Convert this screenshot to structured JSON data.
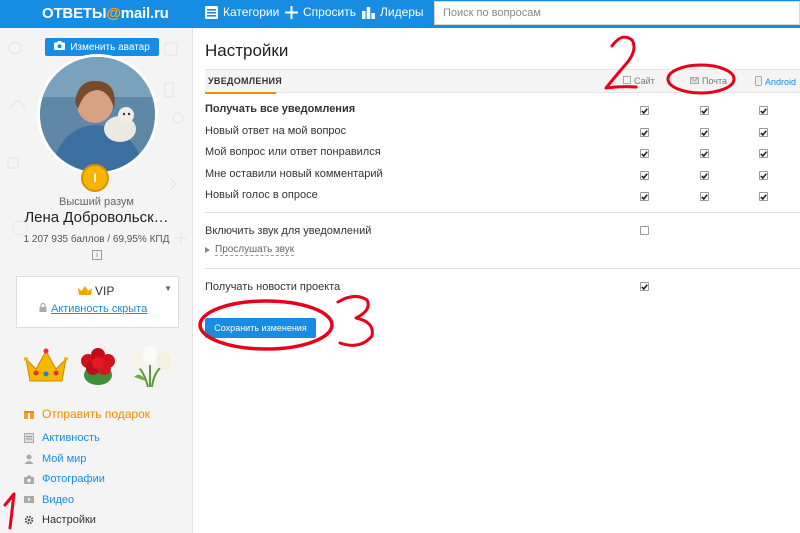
{
  "header": {
    "logo_text": "ОТВЕТЫ",
    "logo_at": "@",
    "logo_mail": "mail.ru",
    "nav": [
      {
        "label": "Категории",
        "icon": "categories-icon"
      },
      {
        "label": "Спросить",
        "icon": "plus-icon"
      },
      {
        "label": "Лидеры",
        "icon": "leaders-icon"
      }
    ],
    "search_placeholder": "Поиск по вопросам",
    "bg_color": "#168de2"
  },
  "sidebar": {
    "change_avatar": "Изменить аватар",
    "rank": "Высший разум",
    "username": "Лена Добровольск…",
    "score": "1 207 935 баллов / 69,95% КПД",
    "vip_label": "VIP",
    "activity_hidden": "Активность скрыта",
    "gifts": [
      "crown",
      "roses",
      "tulips"
    ],
    "menu": [
      {
        "label": "Отправить подарок",
        "icon": "gift-icon"
      },
      {
        "label": "Активность",
        "icon": "activity-icon"
      },
      {
        "label": "Мой мир",
        "icon": "myworld-icon"
      },
      {
        "label": "Фотографии",
        "icon": "camera-icon"
      },
      {
        "label": "Видео",
        "icon": "video-icon"
      },
      {
        "label": "Настройки",
        "icon": "gear-icon"
      }
    ]
  },
  "main": {
    "title": "Настройки",
    "tab": "УВЕДОМЛЕНИЯ",
    "columns": [
      {
        "label": "Сайт",
        "icon": "site-icon"
      },
      {
        "label": "Почта",
        "icon": "mail-icon"
      },
      {
        "label": "Android",
        "icon": "android-icon"
      }
    ],
    "rows": [
      {
        "label": "Получать все уведомления",
        "bold": true,
        "checks": [
          true,
          true,
          true
        ]
      },
      {
        "label": "Новый ответ на мой вопрос",
        "bold": false,
        "checks": [
          true,
          true,
          true
        ]
      },
      {
        "label": "Мой вопрос или ответ понравился",
        "bold": false,
        "checks": [
          true,
          true,
          true
        ]
      },
      {
        "label": "Мне оставили новый комментарий",
        "bold": false,
        "checks": [
          true,
          true,
          true
        ]
      },
      {
        "label": "Новый голос в опросе",
        "bold": false,
        "checks": [
          true,
          true,
          true
        ]
      }
    ],
    "sound_label": "Включить звук для уведомлений",
    "sound_checked": false,
    "listen_label": "Прослушать звук",
    "news_label": "Получать новости проекта",
    "news_checked": true,
    "save_label": "Сохранить изменения"
  },
  "annotations": {
    "numbers": [
      "1",
      "2",
      "3"
    ],
    "color": "#e8001c"
  }
}
